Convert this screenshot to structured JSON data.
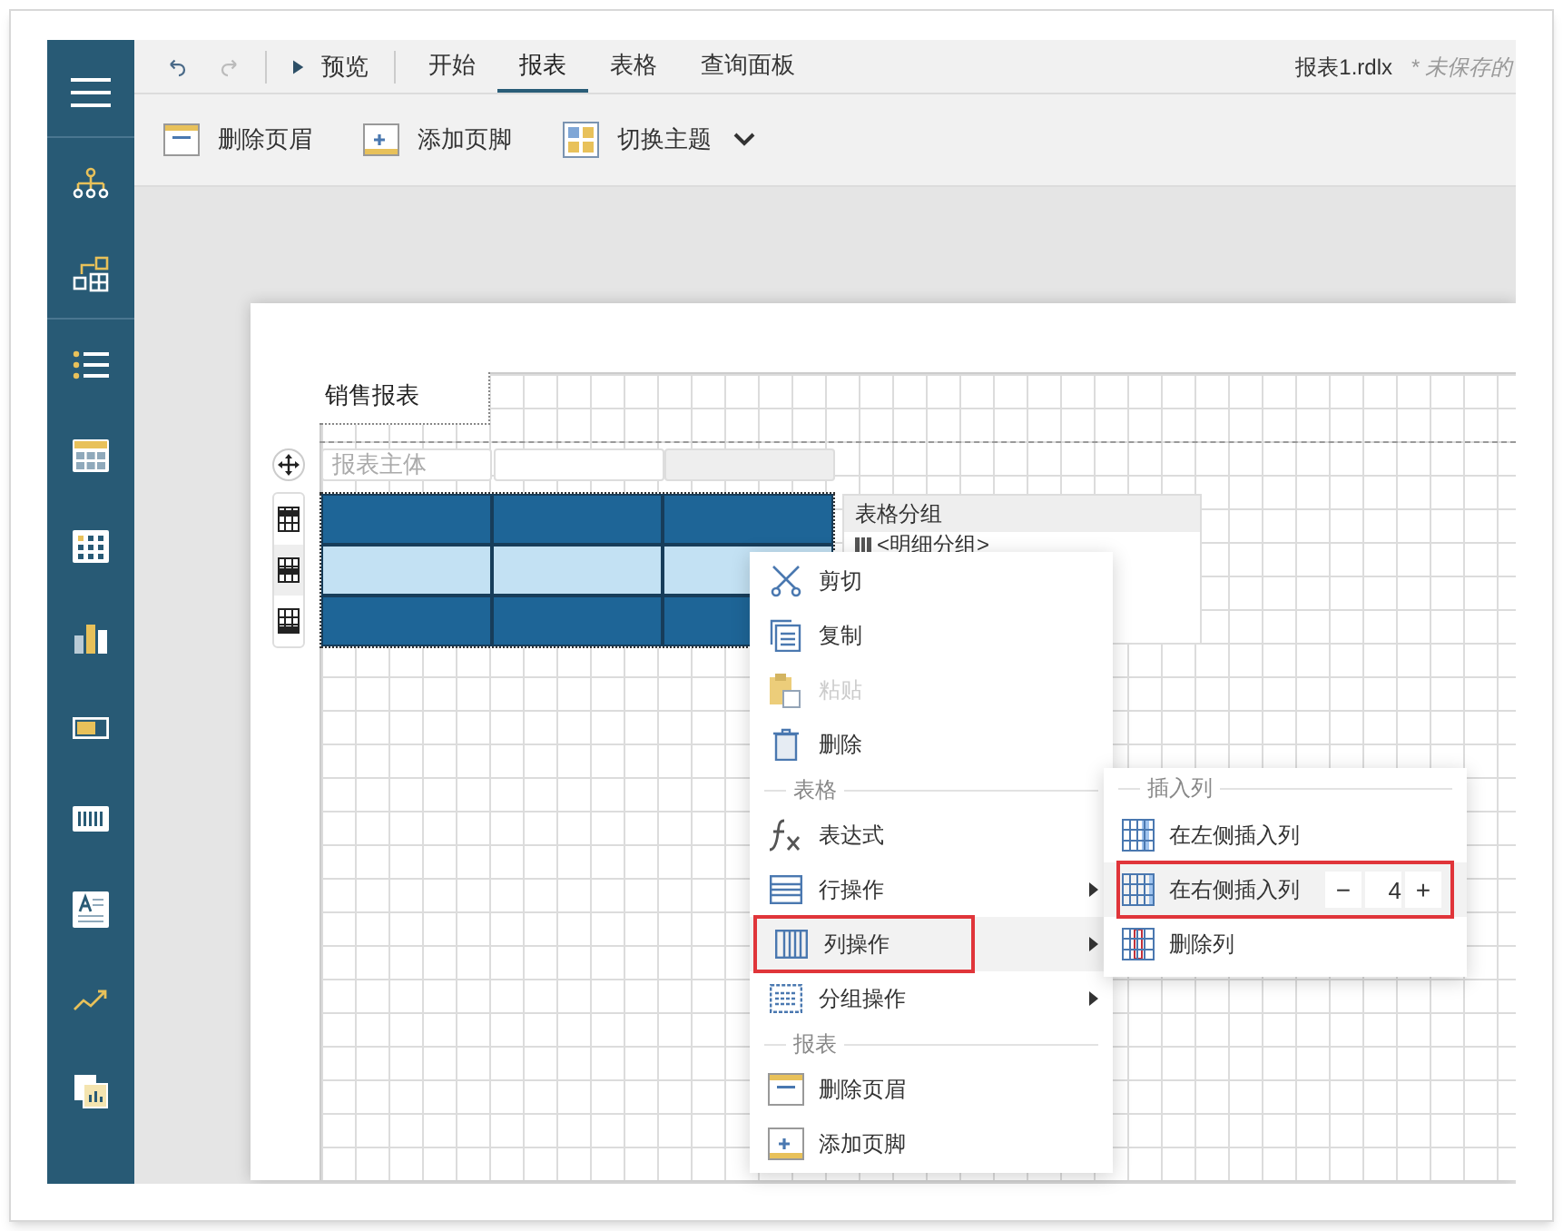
{
  "quick_actions": [
    {
      "kind": "undo",
      "disabled": false
    },
    {
      "kind": "redo",
      "disabled": true
    },
    {
      "kind": "preview",
      "label": "预览",
      "disabled": false
    }
  ],
  "tabs": [
    {
      "label": "开始",
      "selected": false
    },
    {
      "label": "报表",
      "selected": true
    },
    {
      "label": "表格",
      "selected": false
    },
    {
      "label": "查询面板",
      "selected": false
    }
  ],
  "file_name": "报表1.rdlx",
  "save_status": "* 未保存的",
  "ribbon": [
    {
      "kind": "remove-header",
      "label": "删除页眉",
      "dropdown": false
    },
    {
      "kind": "add-footer",
      "label": "添加页脚",
      "dropdown": false
    },
    {
      "kind": "theme",
      "label": "切换主题",
      "dropdown": true
    }
  ],
  "sidebar": {
    "items": [
      {
        "kind": "menu"
      },
      {
        "kind": "tree"
      },
      {
        "kind": "components"
      },
      {
        "kind": "list"
      },
      {
        "kind": "table"
      },
      {
        "kind": "matrix"
      },
      {
        "kind": "chart"
      },
      {
        "kind": "bar"
      },
      {
        "kind": "barcode"
      },
      {
        "kind": "textbox"
      },
      {
        "kind": "sparkline"
      },
      {
        "kind": "subreport"
      }
    ]
  },
  "report": {
    "title": "销售报表",
    "body_label": "报表主体",
    "rows": [
      {
        "kind": "header"
      },
      {
        "kind": "detail"
      },
      {
        "kind": "footer"
      }
    ]
  },
  "group_panel": {
    "title": "表格分组",
    "items": [
      "<明细分组>"
    ]
  },
  "context_menu": {
    "items": [
      {
        "kind": "command",
        "label": "剪切",
        "disabled": false,
        "selected": false,
        "highlighted": false,
        "submenu": false
      },
      {
        "kind": "command",
        "label": "复制",
        "disabled": false,
        "selected": false,
        "highlighted": false,
        "submenu": false
      },
      {
        "kind": "command",
        "label": "粘贴",
        "disabled": true,
        "selected": false,
        "highlighted": false,
        "submenu": false
      },
      {
        "kind": "command",
        "label": "删除",
        "disabled": false,
        "selected": false,
        "highlighted": false,
        "submenu": false
      },
      {
        "kind": "section",
        "label": "表格"
      },
      {
        "kind": "command",
        "label": "表达式",
        "disabled": false,
        "selected": false,
        "highlighted": false,
        "submenu": false
      },
      {
        "kind": "command",
        "label": "行操作",
        "disabled": false,
        "selected": false,
        "highlighted": false,
        "submenu": true
      },
      {
        "kind": "command",
        "label": "列操作",
        "disabled": false,
        "selected": true,
        "highlighted": true,
        "submenu": true
      },
      {
        "kind": "command",
        "label": "分组操作",
        "disabled": false,
        "selected": false,
        "highlighted": false,
        "submenu": true
      },
      {
        "kind": "section",
        "label": "报表"
      },
      {
        "kind": "command",
        "label": "删除页眉",
        "disabled": false,
        "selected": false,
        "highlighted": false,
        "submenu": false
      },
      {
        "kind": "command",
        "label": "添加页脚",
        "disabled": false,
        "selected": false,
        "highlighted": false,
        "submenu": false
      }
    ]
  },
  "submenu": {
    "section": "插入列",
    "items": [
      {
        "label": "在左侧插入列",
        "highlighted": false
      },
      {
        "label": "在右侧插入列",
        "highlighted": true,
        "decrement": "−",
        "count": "4",
        "increment": "+"
      },
      {
        "label": "删除列",
        "highlighted": false
      }
    ]
  }
}
